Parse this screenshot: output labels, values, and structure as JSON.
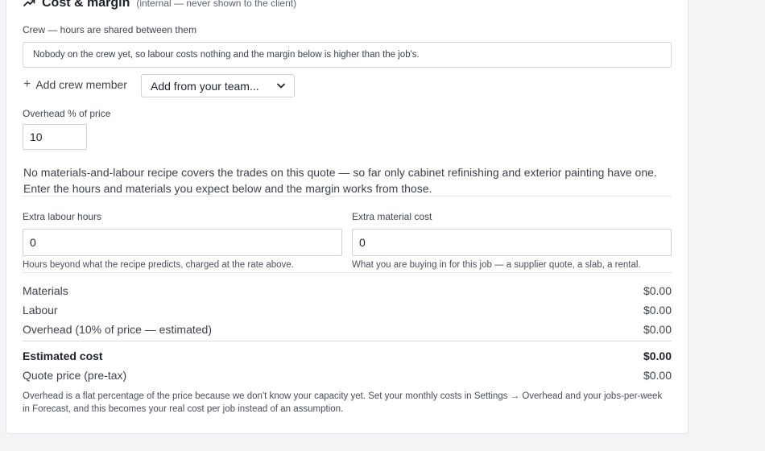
{
  "header": {
    "title": "Cost & margin",
    "subtitle": "(internal — never shown to the client)"
  },
  "crew": {
    "label": "Crew — hours are shared between them",
    "empty_note": "Nobody on the crew yet, so labour costs nothing and the margin below is higher than the job's.",
    "add_label": "Add crew member",
    "team_select_value": "Add from your team..."
  },
  "overhead": {
    "label": "Overhead % of price",
    "value": "10"
  },
  "recipe_notice": "No materials-and-labour recipe covers the trades on this quote — so far only cabinet refinishing and exterior painting have one. Enter the hours and materials you expect below and the margin works from those.",
  "extra_labour": {
    "label": "Extra labour hours",
    "value": "0",
    "help": "Hours beyond what the recipe predicts, charged at the rate above."
  },
  "extra_material": {
    "label": "Extra material cost",
    "value": "0",
    "help": "What you are buying in for this job — a supplier quote, a slab, a rental."
  },
  "breakdown": {
    "materials": {
      "label": "Materials",
      "value": "$0.00"
    },
    "labour": {
      "label": "Labour",
      "value": "$0.00"
    },
    "overhead": {
      "label": "Overhead (10% of price — estimated)",
      "value": "$0.00"
    },
    "estimated_cost": {
      "label": "Estimated cost",
      "value": "$0.00"
    },
    "quote_price": {
      "label": "Quote price (pre-tax)",
      "value": "$0.00"
    }
  },
  "footnote": "Overhead is a flat percentage of the price because we don't know your capacity yet. Set your monthly costs in Settings → Overhead and your jobs-per-week in Forecast, and this becomes your real cost per job instead of an assumption.",
  "icons": {
    "header": "trending-up-icon",
    "add": "plus-icon",
    "select": "chevron-down-icon"
  }
}
